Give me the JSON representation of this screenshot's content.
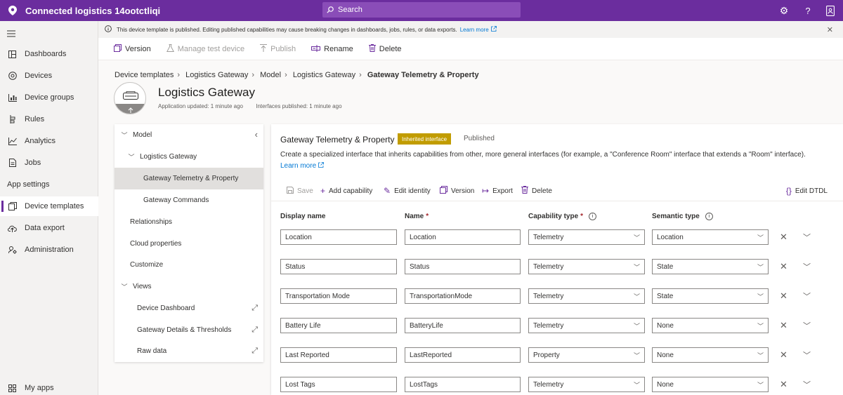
{
  "topbar": {
    "app_title": "Connected logistics 14ootctliqi",
    "search_placeholder": "Search"
  },
  "nav": {
    "items": [
      {
        "label": "Dashboards",
        "name": "dashboards"
      },
      {
        "label": "Devices",
        "name": "devices"
      },
      {
        "label": "Device groups",
        "name": "device-groups"
      },
      {
        "label": "Rules",
        "name": "rules"
      },
      {
        "label": "Analytics",
        "name": "analytics"
      },
      {
        "label": "Jobs",
        "name": "jobs"
      }
    ],
    "section_label": "App settings",
    "settings_items": [
      {
        "label": "Device templates",
        "name": "device-templates",
        "active": true
      },
      {
        "label": "Data export",
        "name": "data-export"
      },
      {
        "label": "Administration",
        "name": "administration"
      }
    ],
    "my_apps": "My apps"
  },
  "banner": {
    "text": "This device template is published. Editing published capabilities may cause breaking changes in dashboards, jobs, rules, or data exports.",
    "link": "Learn more"
  },
  "commands": {
    "version": "Version",
    "manage_test_device": "Manage test device",
    "publish": "Publish",
    "rename": "Rename",
    "delete": "Delete"
  },
  "breadcrumb": [
    "Device templates",
    "Logistics Gateway",
    "Model",
    "Logistics Gateway",
    "Gateway Telemetry & Property"
  ],
  "template": {
    "title": "Logistics Gateway",
    "app_updated": "Application updated: 1 minute ago",
    "interfaces_published": "Interfaces published: 1 minute ago"
  },
  "tree": {
    "items": [
      {
        "label": "Model",
        "level": 0,
        "chevron": "down"
      },
      {
        "label": "Logistics Gateway",
        "level": 1,
        "chevron": "down"
      },
      {
        "label": "Gateway Telemetry & Property",
        "level": 2,
        "selected": true
      },
      {
        "label": "Gateway Commands",
        "level": 2
      },
      {
        "label": "Relationships",
        "level": 0
      },
      {
        "label": "Cloud properties",
        "level": 0
      },
      {
        "label": "Customize",
        "level": 0
      },
      {
        "label": "Views",
        "level": 0,
        "chevron": "down"
      },
      {
        "label": "Device Dashboard",
        "level": 1,
        "expand": true
      },
      {
        "label": "Gateway Details & Thresholds",
        "level": 1,
        "expand": true
      },
      {
        "label": "Raw data",
        "level": 1,
        "expand": true
      }
    ]
  },
  "interface": {
    "title": "Gateway Telemetry & Property",
    "badge": "Inherited interface",
    "status": "Published",
    "description": "Create a specialized interface that inherits capabilities from other, more general interfaces (for example, a \"Conference Room\" interface that extends a \"Room\" interface).",
    "learn_more": "Learn more"
  },
  "content_toolbar": {
    "save": "Save",
    "add_capability": "Add capability",
    "edit_identity": "Edit identity",
    "version": "Version",
    "export": "Export",
    "delete": "Delete",
    "edit_dtdl": "Edit DTDL"
  },
  "columns": {
    "display_name": "Display name",
    "name": "Name",
    "capability_type": "Capability type",
    "semantic_type": "Semantic type"
  },
  "rows": [
    {
      "display_name": "Location",
      "name": "Location",
      "capability_type": "Telemetry",
      "semantic_type": "Location"
    },
    {
      "display_name": "Status",
      "name": "Status",
      "capability_type": "Telemetry",
      "semantic_type": "State"
    },
    {
      "display_name": "Transportation Mode",
      "name": "TransportationMode",
      "capability_type": "Telemetry",
      "semantic_type": "State"
    },
    {
      "display_name": "Battery Life",
      "name": "BatteryLife",
      "capability_type": "Telemetry",
      "semantic_type": "None"
    },
    {
      "display_name": "Last Reported",
      "name": "LastReported",
      "capability_type": "Property",
      "semantic_type": "None"
    },
    {
      "display_name": "Lost Tags",
      "name": "LostTags",
      "capability_type": "Telemetry",
      "semantic_type": "None"
    }
  ],
  "colors": {
    "brand": "#6b2d9e",
    "badge": "#c19c00",
    "link": "#0078d4"
  }
}
